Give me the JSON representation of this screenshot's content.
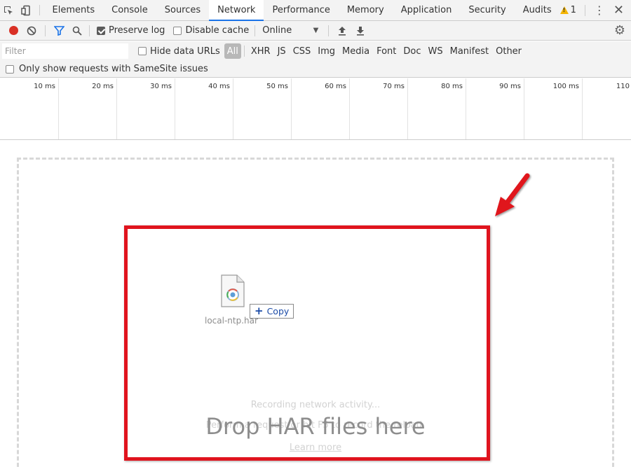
{
  "tabs": {
    "items": [
      {
        "label": "Elements"
      },
      {
        "label": "Console"
      },
      {
        "label": "Sources"
      },
      {
        "label": "Network"
      },
      {
        "label": "Performance"
      },
      {
        "label": "Memory"
      },
      {
        "label": "Application"
      },
      {
        "label": "Security"
      },
      {
        "label": "Audits"
      }
    ],
    "active": "Network",
    "warning_count": "1"
  },
  "toolbar": {
    "preserve_log_label": "Preserve log",
    "preserve_log_checked": true,
    "disable_cache_label": "Disable cache",
    "disable_cache_checked": false,
    "throttle_value": "Online"
  },
  "filter": {
    "placeholder": "Filter",
    "hide_data_urls_label": "Hide data URLs",
    "types": [
      "All",
      "XHR",
      "JS",
      "CSS",
      "Img",
      "Media",
      "Font",
      "Doc",
      "WS",
      "Manifest",
      "Other"
    ],
    "selected_type": "All",
    "samesite_label": "Only show requests with SameSite issues"
  },
  "timeline": {
    "ticks": [
      "10 ms",
      "20 ms",
      "30 ms",
      "40 ms",
      "50 ms",
      "60 ms",
      "70 ms",
      "80 ms",
      "90 ms",
      "100 ms",
      "110"
    ]
  },
  "drop": {
    "recording_text": "Recording network activity...",
    "perform_text": "Perform a request or hit F5 to record the reload.",
    "learn_more": "Learn more",
    "drop_message": "Drop HAR files here",
    "file_name": "local-ntp.har",
    "copy_label": "Copy"
  },
  "colors": {
    "accent": "#1a73e8",
    "record": "#d93025",
    "highlight_border": "#e0141e",
    "warning": "#f4b400"
  }
}
